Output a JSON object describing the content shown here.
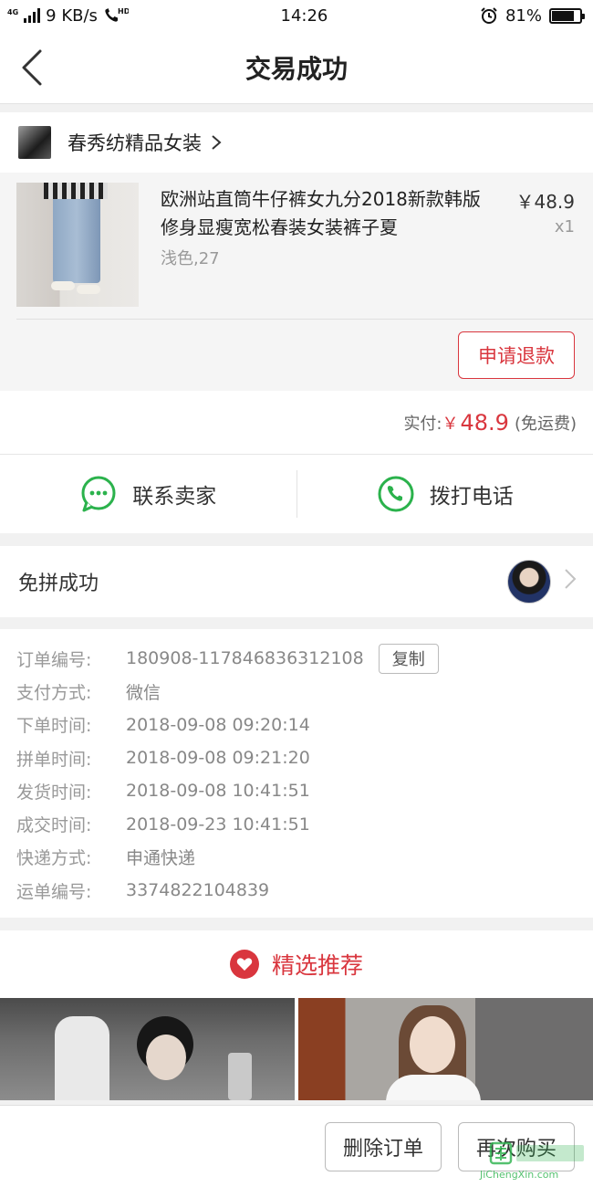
{
  "status_bar": {
    "network": "4G",
    "speed": "9 KB/s",
    "hd_label": "HD",
    "time": "14:26",
    "battery": "81%",
    "battery_level": 0.81
  },
  "header": {
    "title": "交易成功",
    "back_icon": "chevron-left-icon"
  },
  "shop": {
    "name": "春秀纺精品女装"
  },
  "product": {
    "title": "欧洲站直筒牛仔裤女九分2018新款韩版修身显瘦宽松春装女装裤子夏",
    "variant": "浅色,27",
    "price": "￥48.9",
    "quantity": "x1"
  },
  "refund_button": "申请退款",
  "payment": {
    "label": "实付:",
    "currency": "￥",
    "amount": "48.9",
    "note": "(免运费)"
  },
  "contact": {
    "seller_label": "联系卖家",
    "call_label": "拨打电话"
  },
  "group": {
    "label": "免拼成功"
  },
  "order_info": [
    {
      "key": "订单编号:",
      "value": "180908-117846836312108"
    },
    {
      "key": "支付方式:",
      "value": "微信"
    },
    {
      "key": "下单时间:",
      "value": "2018-09-08 09:20:14"
    },
    {
      "key": "拼单时间:",
      "value": "2018-09-08 09:21:20"
    },
    {
      "key": "发货时间:",
      "value": "2018-09-08 10:41:51"
    },
    {
      "key": "成交时间:",
      "value": "2018-09-23 10:41:51"
    },
    {
      "key": "快递方式:",
      "value": "申通快递"
    },
    {
      "key": "运单编号:",
      "value": "3374822104839"
    }
  ],
  "copy_button": "复制",
  "recommend": {
    "title": "精选推荐"
  },
  "bottom": {
    "delete_label": "删除订单",
    "rebuy_label": "再次购买"
  },
  "watermark": {
    "text": "JiChengXin.com",
    "colors": {
      "green": "#2bb24c"
    }
  },
  "colors": {
    "accent": "#d9363e",
    "green": "#2bb24c"
  }
}
